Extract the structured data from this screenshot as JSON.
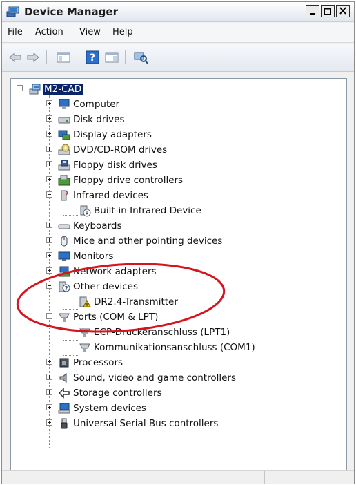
{
  "window": {
    "title": "Device Manager"
  },
  "menu": {
    "file": "File",
    "action": "Action",
    "view": "View",
    "help": "Help"
  },
  "toolbar": [
    "back-arrow-icon",
    "forward-arrow-icon",
    "show-hide-console-tree-icon",
    "help-icon",
    "properties-icon",
    "scan-hardware-icon"
  ],
  "tree": {
    "root": "M2-CAD",
    "items": [
      {
        "label": "Computer",
        "icon": "computer-icon"
      },
      {
        "label": "Disk drives",
        "icon": "disk-drive-icon"
      },
      {
        "label": "Display adapters",
        "icon": "display-adapter-icon"
      },
      {
        "label": "DVD/CD-ROM drives",
        "icon": "dvd-drive-icon"
      },
      {
        "label": "Floppy disk drives",
        "icon": "floppy-drive-icon"
      },
      {
        "label": "Floppy drive controllers",
        "icon": "floppy-controller-icon"
      },
      {
        "label": "Infrared devices",
        "icon": "infrared-icon",
        "children": [
          "Built-in Infrared Device"
        ]
      },
      {
        "label": "Keyboards",
        "icon": "keyboard-icon"
      },
      {
        "label": "Mice and other pointing devices",
        "icon": "mouse-icon"
      },
      {
        "label": "Monitors",
        "icon": "monitor-icon"
      },
      {
        "label": "Network adapters",
        "icon": "network-adapter-icon"
      },
      {
        "label": "Other devices",
        "icon": "unknown-device-icon",
        "children": [
          "DR2.4-Transmitter"
        ]
      },
      {
        "label": "Ports (COM & LPT)",
        "icon": "port-icon",
        "children": [
          "ECP-Druckeranschluss (LPT1)",
          "Kommunikationsanschluss (COM1)"
        ]
      },
      {
        "label": "Processors",
        "icon": "processor-icon"
      },
      {
        "label": "Sound, video and game controllers",
        "icon": "sound-icon"
      },
      {
        "label": "Storage controllers",
        "icon": "storage-controller-icon"
      },
      {
        "label": "System devices",
        "icon": "system-device-icon"
      },
      {
        "label": "Universal Serial Bus controllers",
        "icon": "usb-icon"
      }
    ]
  },
  "colors": {
    "selection": "#0a246a",
    "annotation_circle": "#d7141e",
    "warning": "#f2c200"
  }
}
